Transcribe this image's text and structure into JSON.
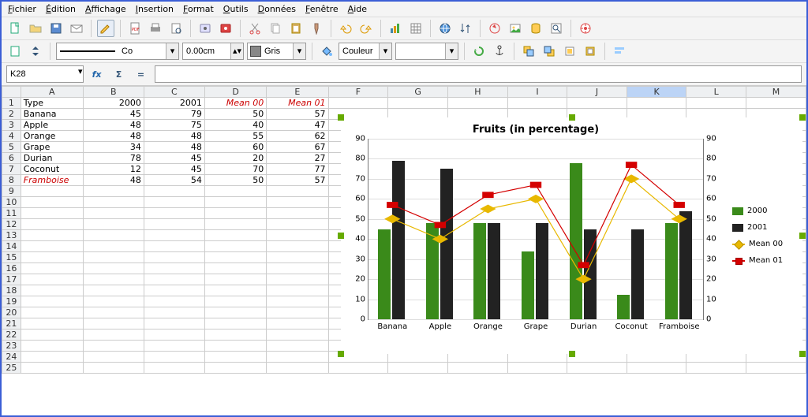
{
  "menus": [
    "Fichier",
    "Édition",
    "Affichage",
    "Insertion",
    "Format",
    "Outils",
    "Données",
    "Fenêtre",
    "Aide"
  ],
  "toolbar2": {
    "line_style": "Co",
    "line_width": "0.00cm",
    "color_name": "Gris",
    "fill_label": "Couleur"
  },
  "namebox": "K28",
  "columns": [
    "A",
    "B",
    "C",
    "D",
    "E",
    "F",
    "G",
    "H",
    "I",
    "J",
    "K",
    "L",
    "M"
  ],
  "selected_col": "K",
  "headers": {
    "A": "Type",
    "B": "2000",
    "C": "2001",
    "D": "Mean 00",
    "E": "Mean 01"
  },
  "rows": [
    {
      "A": "Banana",
      "B": 45,
      "C": 79,
      "D": 50,
      "E": 57
    },
    {
      "A": "Apple",
      "B": 48,
      "C": 75,
      "D": 40,
      "E": 47
    },
    {
      "A": "Orange",
      "B": 48,
      "C": 48,
      "D": 55,
      "E": 62
    },
    {
      "A": "Grape",
      "B": 34,
      "C": 48,
      "D": 60,
      "E": 67
    },
    {
      "A": "Durian",
      "B": 78,
      "C": 45,
      "D": 20,
      "E": 27
    },
    {
      "A": "Coconut",
      "B": 12,
      "C": 45,
      "D": 70,
      "E": 77
    },
    {
      "A": "Framboise",
      "B": 48,
      "C": 54,
      "D": 50,
      "E": 57
    }
  ],
  "chart_data": {
    "type": "bar",
    "title": "Fruits (in percentage)",
    "categories": [
      "Banana",
      "Apple",
      "Orange",
      "Grape",
      "Durian",
      "Coconut",
      "Framboise"
    ],
    "ylim": [
      0,
      90
    ],
    "yticks": [
      0,
      10,
      20,
      30,
      40,
      50,
      60,
      70,
      80,
      90
    ],
    "series": [
      {
        "name": "2000",
        "type": "bar",
        "color": "#3a8a1a",
        "values": [
          45,
          48,
          48,
          34,
          78,
          12,
          48
        ]
      },
      {
        "name": "2001",
        "type": "bar",
        "color": "#222222",
        "values": [
          79,
          75,
          48,
          48,
          45,
          45,
          54
        ]
      },
      {
        "name": "Mean 00",
        "type": "line",
        "color": "#e8b800",
        "values": [
          50,
          40,
          55,
          60,
          20,
          70,
          50
        ]
      },
      {
        "name": "Mean 01",
        "type": "line",
        "color": "#d40000",
        "values": [
          57,
          47,
          62,
          67,
          27,
          77,
          57
        ]
      }
    ],
    "legend_position": "right"
  }
}
